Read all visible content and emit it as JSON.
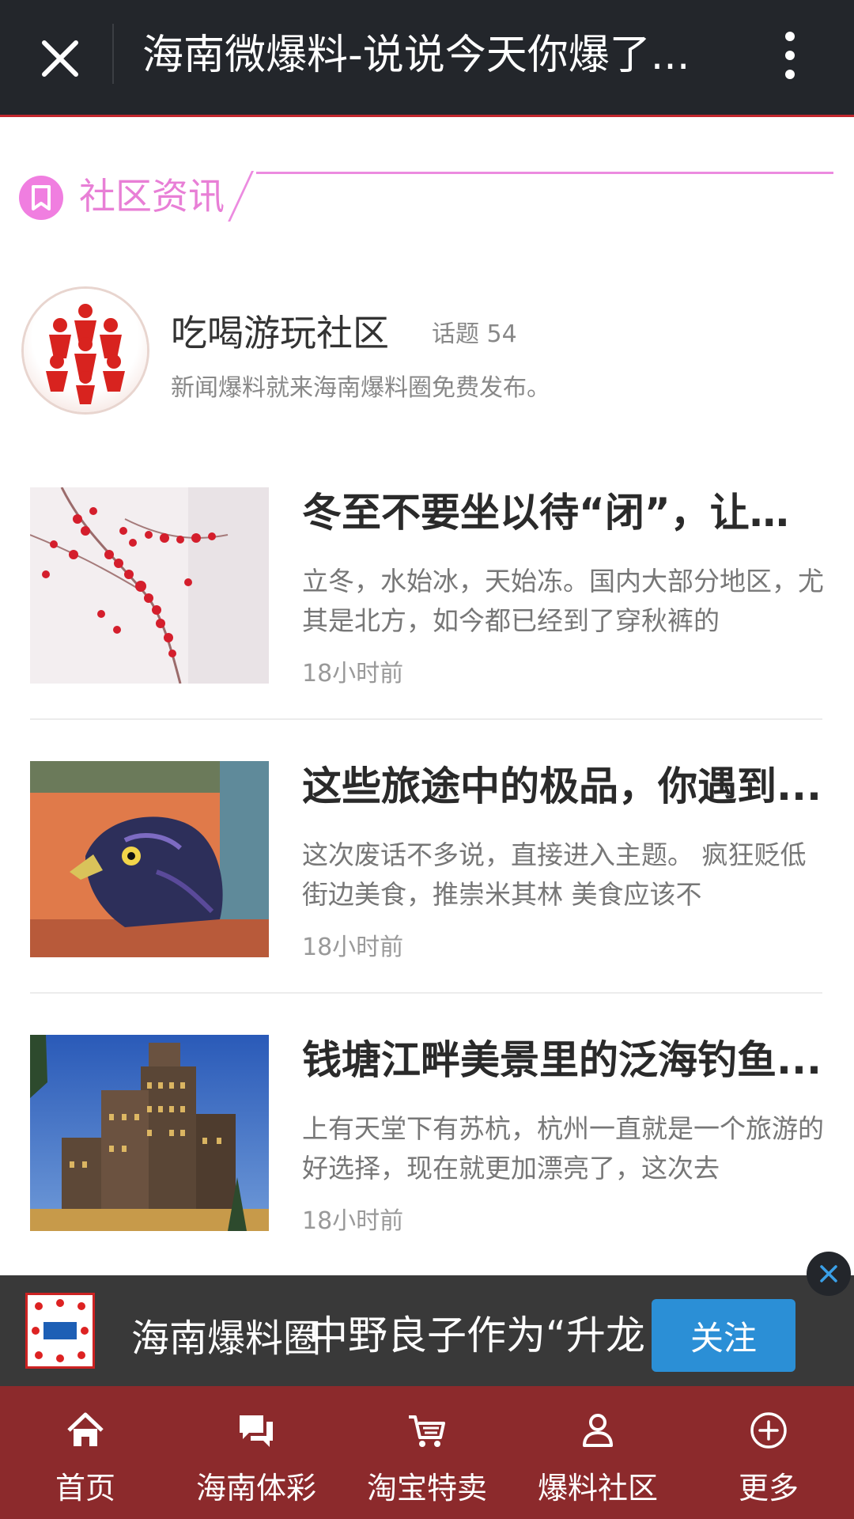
{
  "header": {
    "title": "海南微爆料-说说今天你爆了...",
    "close_icon": "close-icon",
    "more_icon": "more-vertical-icon"
  },
  "section": {
    "title": "社区资讯",
    "icon": "bookmark-icon",
    "accent_color": "#e87fd6"
  },
  "community": {
    "name": "吃喝游玩社区",
    "topics": "话题 54",
    "description": "新闻爆料就来海南爆料圈免费发布。"
  },
  "articles": [
    {
      "title": "冬至不要坐以待“闭”，让我...",
      "summary": "立冬，水始冰，天始冻。国内大部分地区，尤其是北方，如今都已经到了穿秋裤的",
      "time": "18小时前"
    },
    {
      "title": "这些旅途中的极品，你遇到...",
      "summary": "这次废话不多说，直接进入主题。 疯狂贬低街边美食，推崇米其林 美食应该不",
      "time": "18小时前"
    },
    {
      "title": "钱塘江畔美景里的泛海钓鱼...",
      "summary": "上有天堂下有苏杭，杭州一直就是一个旅游的好选择，现在就更加漂亮了，这次去",
      "time": "18小时前"
    }
  ],
  "follow_banner": {
    "name": "海南爆料圈",
    "obscured_text": "中野良子作为“升龙",
    "button": "关注",
    "button_color": "#2b8fd6"
  },
  "bottom_nav": [
    {
      "label": "首页",
      "icon": "home-icon"
    },
    {
      "label": "海南体彩",
      "icon": "chat-icon"
    },
    {
      "label": "淘宝特卖",
      "icon": "cart-icon"
    },
    {
      "label": "爆料社区",
      "icon": "user-icon"
    },
    {
      "label": "更多",
      "icon": "plus-circle-icon"
    }
  ],
  "colors": {
    "topbar": "#23262b",
    "bottom_nav": "#8c2a2c"
  }
}
